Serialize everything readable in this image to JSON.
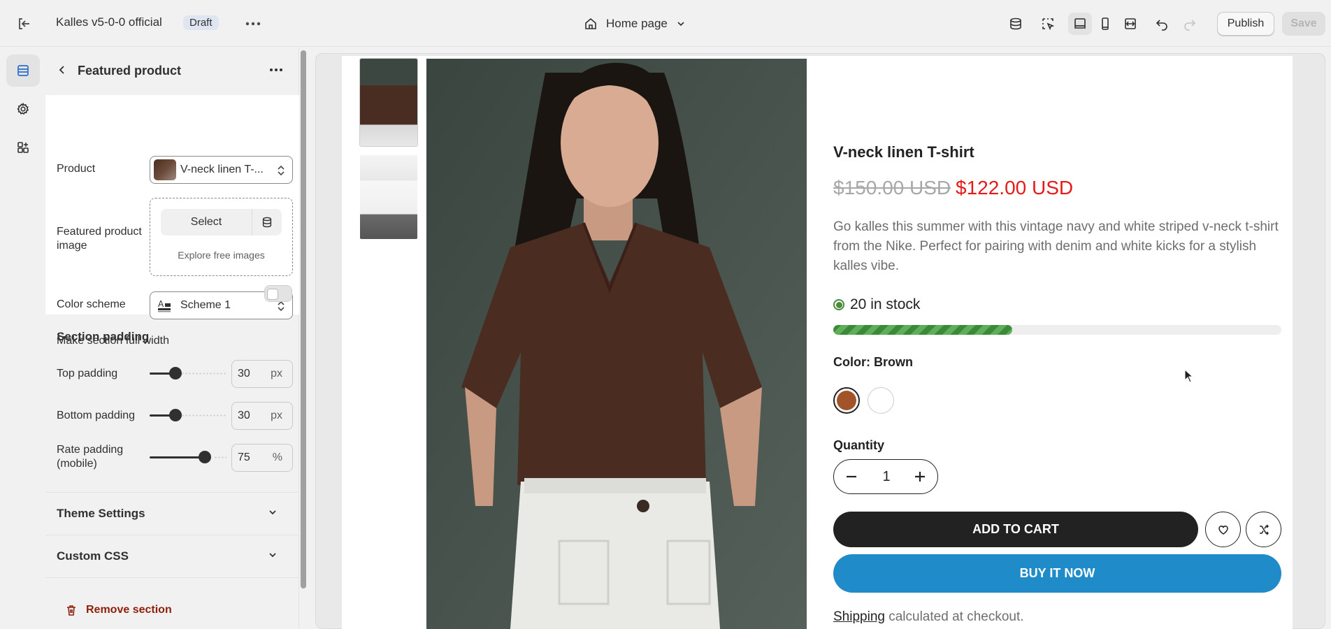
{
  "topbar": {
    "store_name": "Kalles v5-0-0 official",
    "badge": "Draft",
    "page_selector": "Home page",
    "publish_label": "Publish",
    "save_label": "Save"
  },
  "panel": {
    "title": "Featured product",
    "product_label": "Product",
    "product_value": "V-neck linen T-...",
    "image_label": "Featured product image",
    "image_select": "Select",
    "image_explore": "Explore free images",
    "color_scheme_label": "Color scheme",
    "color_scheme_value": "Scheme 1",
    "full_width_label": "Make section full width",
    "full_width_on": false,
    "padding_title": "Section padding",
    "top_padding_label": "Top padding",
    "top_padding_value": "30",
    "top_padding_unit": "px",
    "bottom_padding_label": "Bottom padding",
    "bottom_padding_value": "30",
    "bottom_padding_unit": "px",
    "rate_padding_label": "Rate padding (mobile)",
    "rate_padding_value": "75",
    "rate_padding_unit": "%",
    "theme_settings": "Theme Settings",
    "custom_css": "Custom CSS",
    "remove_section": "Remove section"
  },
  "product": {
    "title": "V-neck linen T-shirt",
    "old_price": "$150.00 USD",
    "new_price": "$122.00 USD",
    "description": "Go kalles this summer with this vintage navy and white striped v-neck t-shirt from the Nike. Perfect for pairing with denim and white kicks for a stylish kalles vibe.",
    "stock_text": "20 in stock",
    "stock_fill_percent": 40,
    "color_label": "Color: Brown",
    "swatches": [
      "#a3532a",
      "#ffffff"
    ],
    "quantity_label": "Quantity",
    "quantity": "1",
    "add_to_cart": "ADD TO CART",
    "buy_now": "BUY IT NOW",
    "shipping_link": "Shipping",
    "shipping_text": " calculated at checkout."
  },
  "colors": {
    "sale_red": "#e41b1b",
    "buy_blue": "#1f8bc8",
    "stock_green": "#4b8b3b"
  }
}
